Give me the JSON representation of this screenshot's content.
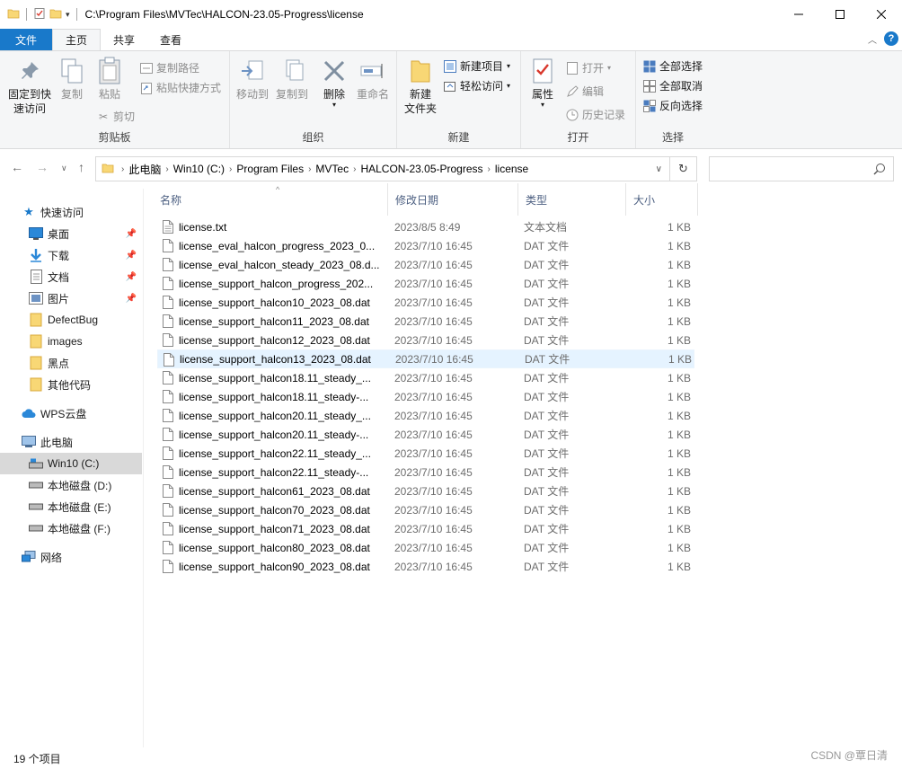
{
  "window": {
    "title": "C:\\Program Files\\MVTec\\HALCON-23.05-Progress\\license",
    "controls": [
      "minimize-icon",
      "maximize-icon",
      "close-icon"
    ]
  },
  "ribbon_tabs": {
    "file": "文件",
    "home": "主页",
    "share": "共享",
    "view": "查看"
  },
  "ribbon": {
    "clipboard": {
      "label": "剪贴板",
      "pin": "固定到快速访问",
      "pin_line1": "固定到快",
      "pin_line2": "速访问",
      "copy": "复制",
      "paste": "粘贴",
      "copy_path": "复制路径",
      "paste_shortcut": "粘贴快捷方式",
      "cut": "剪切"
    },
    "organize": {
      "label": "组织",
      "move_to": "移动到",
      "copy_to": "复制到",
      "delete": "删除",
      "rename": "重命名"
    },
    "new": {
      "label": "新建",
      "new_folder_line1": "新建",
      "new_folder_line2": "文件夹",
      "new_item": "新建项目",
      "easy_access": "轻松访问"
    },
    "open": {
      "label": "打开",
      "properties": "属性",
      "open": "打开",
      "edit": "编辑",
      "history": "历史记录"
    },
    "select": {
      "label": "选择",
      "select_all": "全部选择",
      "select_none": "全部取消",
      "invert": "反向选择"
    }
  },
  "address": {
    "crumbs": [
      "此电脑",
      "Win10 (C:)",
      "Program Files",
      "MVTec",
      "HALCON-23.05-Progress",
      "license"
    ]
  },
  "nav": {
    "quick_access": "快速访问",
    "desktop": "桌面",
    "downloads": "下载",
    "documents": "文档",
    "pictures": "图片",
    "defectbug": "DefectBug",
    "images": "images",
    "heidian": "黑点",
    "other_code": "其他代码",
    "wps": "WPS云盘",
    "this_pc": "此电脑",
    "c_drive": "Win10 (C:)",
    "d_drive": "本地磁盘 (D:)",
    "e_drive": "本地磁盘 (E:)",
    "f_drive": "本地磁盘 (F:)",
    "network": "网络"
  },
  "columns": {
    "name": "名称",
    "date": "修改日期",
    "type": "类型",
    "size": "大小"
  },
  "files": [
    {
      "name": "license.txt",
      "date": "2023/8/5 8:49",
      "type": "文本文档",
      "size": "1 KB"
    },
    {
      "name": "license_eval_halcon_progress_2023_0...",
      "date": "2023/7/10 16:45",
      "type": "DAT 文件",
      "size": "1 KB"
    },
    {
      "name": "license_eval_halcon_steady_2023_08.d...",
      "date": "2023/7/10 16:45",
      "type": "DAT 文件",
      "size": "1 KB"
    },
    {
      "name": "license_support_halcon_progress_202...",
      "date": "2023/7/10 16:45",
      "type": "DAT 文件",
      "size": "1 KB"
    },
    {
      "name": "license_support_halcon10_2023_08.dat",
      "date": "2023/7/10 16:45",
      "type": "DAT 文件",
      "size": "1 KB"
    },
    {
      "name": "license_support_halcon11_2023_08.dat",
      "date": "2023/7/10 16:45",
      "type": "DAT 文件",
      "size": "1 KB"
    },
    {
      "name": "license_support_halcon12_2023_08.dat",
      "date": "2023/7/10 16:45",
      "type": "DAT 文件",
      "size": "1 KB"
    },
    {
      "name": "license_support_halcon13_2023_08.dat",
      "date": "2023/7/10 16:45",
      "type": "DAT 文件",
      "size": "1 KB"
    },
    {
      "name": "license_support_halcon18.11_steady_...",
      "date": "2023/7/10 16:45",
      "type": "DAT 文件",
      "size": "1 KB"
    },
    {
      "name": "license_support_halcon18.11_steady-...",
      "date": "2023/7/10 16:45",
      "type": "DAT 文件",
      "size": "1 KB"
    },
    {
      "name": "license_support_halcon20.11_steady_...",
      "date": "2023/7/10 16:45",
      "type": "DAT 文件",
      "size": "1 KB"
    },
    {
      "name": "license_support_halcon20.11_steady-...",
      "date": "2023/7/10 16:45",
      "type": "DAT 文件",
      "size": "1 KB"
    },
    {
      "name": "license_support_halcon22.11_steady_...",
      "date": "2023/7/10 16:45",
      "type": "DAT 文件",
      "size": "1 KB"
    },
    {
      "name": "license_support_halcon22.11_steady-...",
      "date": "2023/7/10 16:45",
      "type": "DAT 文件",
      "size": "1 KB"
    },
    {
      "name": "license_support_halcon61_2023_08.dat",
      "date": "2023/7/10 16:45",
      "type": "DAT 文件",
      "size": "1 KB"
    },
    {
      "name": "license_support_halcon70_2023_08.dat",
      "date": "2023/7/10 16:45",
      "type": "DAT 文件",
      "size": "1 KB"
    },
    {
      "name": "license_support_halcon71_2023_08.dat",
      "date": "2023/7/10 16:45",
      "type": "DAT 文件",
      "size": "1 KB"
    },
    {
      "name": "license_support_halcon80_2023_08.dat",
      "date": "2023/7/10 16:45",
      "type": "DAT 文件",
      "size": "1 KB"
    },
    {
      "name": "license_support_halcon90_2023_08.dat",
      "date": "2023/7/10 16:45",
      "type": "DAT 文件",
      "size": "1 KB"
    }
  ],
  "hovered_row": 7,
  "status": {
    "count": "19 个项目"
  },
  "watermark": "CSDN @覃日清",
  "colors": {
    "accent": "#1979ca",
    "folder": "#f8d775",
    "hover_row": "#e5f3ff",
    "selected_nav": "#d9d9d9"
  }
}
